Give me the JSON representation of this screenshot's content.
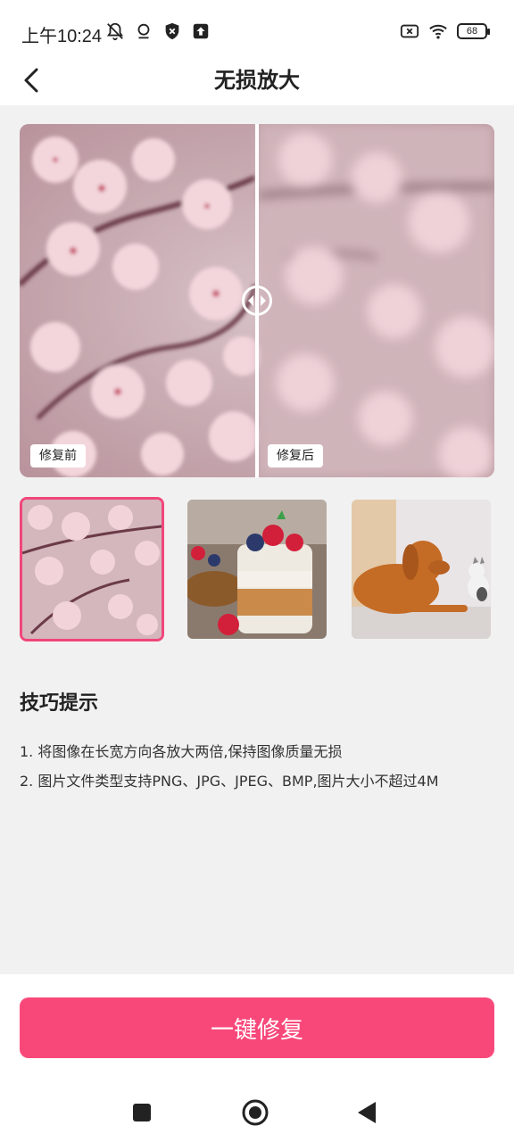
{
  "status_bar": {
    "time": "上午10:24",
    "battery": "68"
  },
  "header": {
    "title": "无损放大"
  },
  "compare": {
    "before_label": "修复前",
    "after_label": "修复后"
  },
  "samples": [
    {
      "name": "cherry-blossom",
      "selected": true
    },
    {
      "name": "berry-parfait",
      "selected": false
    },
    {
      "name": "dog-and-cat",
      "selected": false
    }
  ],
  "tips": {
    "title": "技巧提示",
    "items": [
      "1. 将图像在长宽方向各放大两倍,保持图像质量无损",
      "2. 图片文件类型支持PNG、JPG、JPEG、BMP,图片大小不超过4M"
    ]
  },
  "action": {
    "label": "一键修复"
  },
  "colors": {
    "accent": "#f8487a",
    "selected_border": "#f0467a"
  }
}
